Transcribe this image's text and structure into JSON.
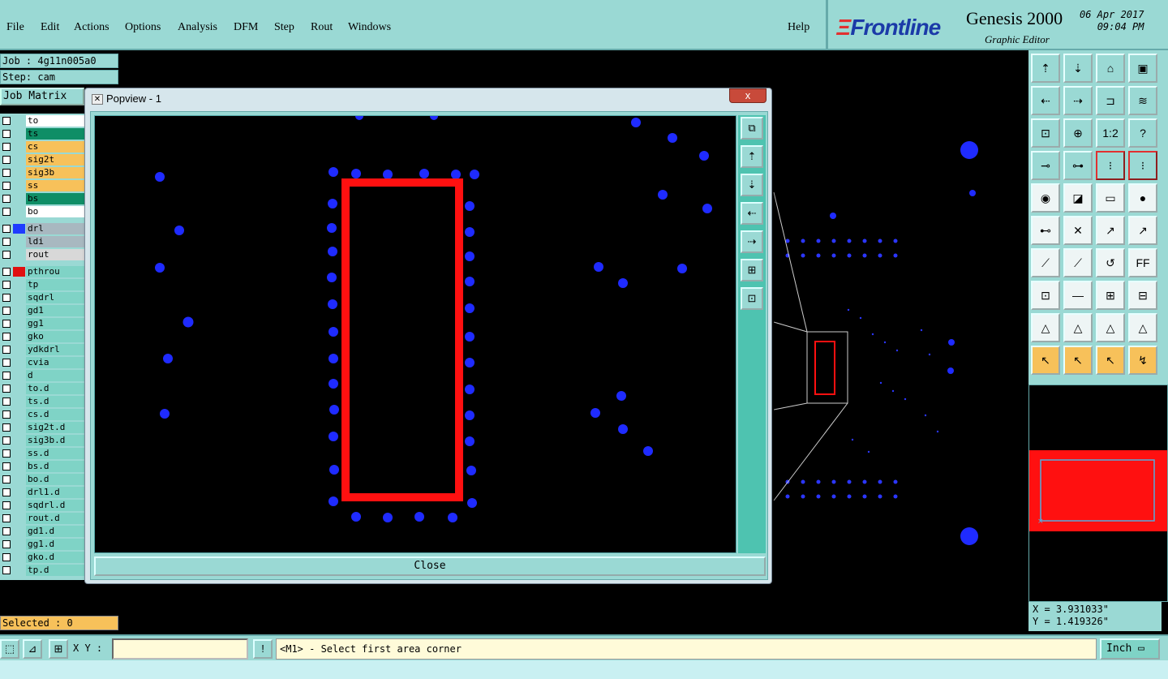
{
  "menubar": {
    "items": [
      {
        "label": "File",
        "u": "F"
      },
      {
        "label": "Edit",
        "u": "E"
      },
      {
        "label": "Actions",
        "u": "A"
      },
      {
        "label": "Options",
        "u": ""
      },
      {
        "label": "Analysis",
        "u": ""
      },
      {
        "label": "DFM",
        "u": ""
      },
      {
        "label": "Step",
        "u": "S"
      },
      {
        "label": "Rout",
        "u": "R"
      },
      {
        "label": "Windows",
        "u": "W"
      }
    ],
    "help": "Help"
  },
  "brand": {
    "logo": "Frontline",
    "title": "Genesis 2000",
    "subtitle": "Graphic Editor",
    "date": "06 Apr 2017",
    "time": "09:04 PM"
  },
  "job": {
    "job_line": "Job : 4g11n005a0",
    "step_line": "Step: cam",
    "matrix_label": "Job Matrix"
  },
  "layers": [
    {
      "name": "to",
      "color": "#ffffff",
      "swatch": ""
    },
    {
      "name": "ts",
      "color": "#0f8e66",
      "swatch": ""
    },
    {
      "name": "cs",
      "color": "#f7c15a",
      "swatch": ""
    },
    {
      "name": "sig2t",
      "color": "#f7c15a",
      "swatch": ""
    },
    {
      "name": "sig3b",
      "color": "#f7c15a",
      "swatch": ""
    },
    {
      "name": "ss",
      "color": "#f7c15a",
      "swatch": ""
    },
    {
      "name": "bs",
      "color": "#0f8e66",
      "swatch": ""
    },
    {
      "name": "bo",
      "color": "#ffffff",
      "swatch": ""
    },
    {
      "name": "drl",
      "color": "#a8b8c0",
      "swatch": "#1f3cff"
    },
    {
      "name": "ldi",
      "color": "#a8b8c0",
      "swatch": ""
    },
    {
      "name": "rout",
      "color": "#d8d8d8",
      "swatch": ""
    },
    {
      "name": "pthrou",
      "color": "#7fd3c6",
      "swatch": "#e01010"
    },
    {
      "name": "tp",
      "color": "#7fd3c6",
      "swatch": ""
    },
    {
      "name": "sqdrl",
      "color": "#7fd3c6",
      "swatch": ""
    },
    {
      "name": "gd1",
      "color": "#7fd3c6",
      "swatch": ""
    },
    {
      "name": "gg1",
      "color": "#7fd3c6",
      "swatch": ""
    },
    {
      "name": "gko",
      "color": "#7fd3c6",
      "swatch": ""
    },
    {
      "name": "ydkdrl",
      "color": "#7fd3c6",
      "swatch": ""
    },
    {
      "name": "cvia",
      "color": "#7fd3c6",
      "swatch": ""
    },
    {
      "name": "d",
      "color": "#7fd3c6",
      "swatch": ""
    },
    {
      "name": "to.d",
      "color": "#7fd3c6",
      "swatch": ""
    },
    {
      "name": "ts.d",
      "color": "#7fd3c6",
      "swatch": ""
    },
    {
      "name": "cs.d",
      "color": "#7fd3c6",
      "swatch": ""
    },
    {
      "name": "sig2t.d",
      "color": "#7fd3c6",
      "swatch": ""
    },
    {
      "name": "sig3b.d",
      "color": "#7fd3c6",
      "swatch": ""
    },
    {
      "name": "ss.d",
      "color": "#7fd3c6",
      "swatch": ""
    },
    {
      "name": "bs.d",
      "color": "#7fd3c6",
      "swatch": ""
    },
    {
      "name": "bo.d",
      "color": "#7fd3c6",
      "swatch": ""
    },
    {
      "name": "drl1.d",
      "color": "#7fd3c6",
      "swatch": ""
    },
    {
      "name": "sqdrl.d",
      "color": "#7fd3c6",
      "swatch": ""
    },
    {
      "name": "rout.d",
      "color": "#7fd3c6",
      "swatch": ""
    },
    {
      "name": "gd1.d",
      "color": "#7fd3c6",
      "swatch": ""
    },
    {
      "name": "gg1.d",
      "color": "#7fd3c6",
      "swatch": ""
    },
    {
      "name": "gko.d",
      "color": "#7fd3c6",
      "swatch": ""
    },
    {
      "name": "tp.d",
      "color": "#7fd3c6",
      "swatch": ""
    }
  ],
  "selected": "Selected : 0",
  "popview": {
    "title": "Popview - 1",
    "close_x": "x",
    "close_label": "Close"
  },
  "coords": {
    "x": "X = 3.931033\"",
    "y": "Y = 1.419326\""
  },
  "bottombar": {
    "xy_label": "X Y :",
    "xy_value": "",
    "prompt": "<M1> - Select first area corner",
    "units": "Inch"
  },
  "colors": {
    "panel": "#9ad9d4",
    "pad": "#1f2bff",
    "outline": "#ff1010"
  }
}
